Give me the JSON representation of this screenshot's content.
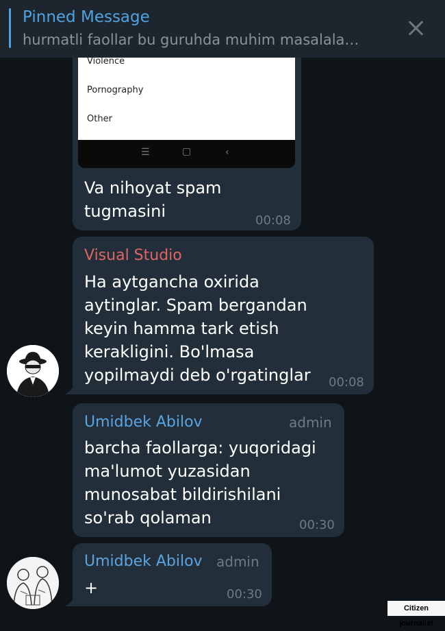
{
  "pinned": {
    "title": "Pinned Message",
    "text": "hurmatli faollar bu guruhda muhim masalala…"
  },
  "messages": [
    {
      "image_options": [
        "Violence",
        "Pornography",
        "Other"
      ],
      "text": "Va nihoyat spam\ntugmasini",
      "time": "00:08"
    },
    {
      "sender": "Visual Studio",
      "sender_color": "#e06565",
      "text": "Ha aytgancha oxirida\naytinglar. Spam bergandan\nkeyin hamma tark etish\nkerakligini. Bo'lmasa\nyopilmaydi deb o'rgatinglar",
      "time": "00:08"
    },
    {
      "sender": "Umidbek Abilov",
      "sender_color": "#5aa4e0",
      "badge": "admin",
      "text": "barcha faollarga: yuqoridagi\nma'lumot yuzasidan\nmunosabat bildirishilani\nso'rab qolaman",
      "time": "00:30"
    },
    {
      "sender": "Umidbek Abilov",
      "sender_color": "#5aa4e0",
      "badge": "admin",
      "text": "+",
      "time": "00:30"
    }
  ],
  "credit": "Citizen journalist"
}
